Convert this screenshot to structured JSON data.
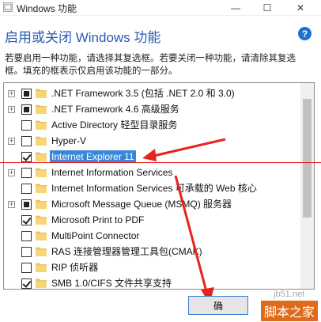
{
  "window": {
    "title": "Windows 功能",
    "minimize_glyph": "—",
    "maximize_glyph": "☐",
    "close_glyph": "✕"
  },
  "heading": "启用或关闭 Windows 功能",
  "help_glyph": "?",
  "description": "若要启用一种功能，请选择其复选框。若要关闭一种功能，请清除其复选框。填充的框表示仅启用该功能的一部分。",
  "features": [
    {
      "label": ".NET Framework 3.5 (包括 .NET 2.0 和 3.0)",
      "expandable": true,
      "state": "partial"
    },
    {
      "label": ".NET Framework 4.6 高级服务",
      "expandable": true,
      "state": "partial"
    },
    {
      "label": "Active Directory 轻型目录服务",
      "expandable": false,
      "state": "unchecked"
    },
    {
      "label": "Hyper-V",
      "expandable": true,
      "state": "unchecked"
    },
    {
      "label": "Internet Explorer 11",
      "expandable": false,
      "state": "checked",
      "selected": true
    },
    {
      "label": "Internet Information Services",
      "expandable": true,
      "state": "unchecked"
    },
    {
      "label": "Internet Information Services 可承载的 Web 核心",
      "expandable": false,
      "state": "unchecked"
    },
    {
      "label": "Microsoft Message Queue (MSMQ) 服务器",
      "expandable": true,
      "state": "partial"
    },
    {
      "label": "Microsoft Print to PDF",
      "expandable": false,
      "state": "checked"
    },
    {
      "label": "MultiPoint Connector",
      "expandable": false,
      "state": "unchecked"
    },
    {
      "label": "RAS 连接管理器管理工具包(CMAK)",
      "expandable": false,
      "state": "unchecked"
    },
    {
      "label": "RIP 侦听器",
      "expandable": false,
      "state": "unchecked"
    },
    {
      "label": "SMB 1.0/CIFS 文件共享支持",
      "expandable": false,
      "state": "checked"
    }
  ],
  "ok_button": "确",
  "watermark": {
    "site": "jb51.net",
    "brand": "脚本之家"
  },
  "colors": {
    "heading": "#2a5bb0",
    "selection": "#3a87d8",
    "arrow": "#e8231d"
  }
}
